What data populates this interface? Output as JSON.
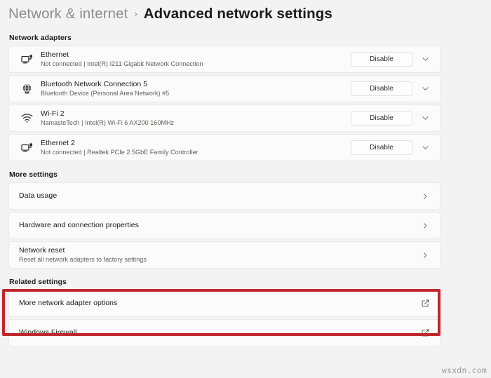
{
  "breadcrumb": {
    "parent": "Network & internet",
    "separator": "›",
    "current": "Advanced network settings"
  },
  "sections": {
    "network_adapters": {
      "label": "Network adapters",
      "adapters": [
        {
          "icon": "ethernet-icon",
          "title": "Ethernet",
          "subtitle": "Not connected | Intel(R) I211 Gigabit Network Connection",
          "button_label": "Disable",
          "expander": "chevron-down-icon"
        },
        {
          "icon": "bluetooth-network-icon",
          "title": "Bluetooth Network Connection 5",
          "subtitle": "Bluetooth Device (Personal Area Network) #5",
          "button_label": "Disable",
          "expander": "chevron-down-icon"
        },
        {
          "icon": "wifi-icon",
          "title": "Wi-Fi 2",
          "subtitle": "NamasteTech | Intel(R) Wi-Fi 6 AX200 160MHz",
          "button_label": "Disable",
          "expander": "chevron-down-icon"
        },
        {
          "icon": "ethernet-icon",
          "title": "Ethernet 2",
          "subtitle": "Not connected | Realtek PCIe 2.5GbE Family Controller",
          "button_label": "Disable",
          "expander": "chevron-down-icon"
        }
      ]
    },
    "more_settings": {
      "label": "More settings",
      "items": [
        {
          "title": "Data usage",
          "subtitle": "",
          "action_icon": "chevron-right-icon"
        },
        {
          "title": "Hardware and connection properties",
          "subtitle": "",
          "action_icon": "chevron-right-icon"
        },
        {
          "title": "Network reset",
          "subtitle": "Reset all network adapters to factory settings",
          "action_icon": "chevron-right-icon"
        }
      ]
    },
    "related_settings": {
      "label": "Related settings",
      "items": [
        {
          "title": "More network adapter options",
          "subtitle": "",
          "action_icon": "external-link-icon"
        },
        {
          "title": "Windows Firewall",
          "subtitle": "",
          "action_icon": "external-link-icon"
        }
      ]
    }
  },
  "annotation": {
    "color": "#c0272d",
    "target": "More network adapter options"
  },
  "watermark": "wsxdn.com",
  "colors": {
    "page_background": "#f3f3f3",
    "card_background": "#fbfbfb",
    "card_border": "#e9e9e9",
    "text_primary": "#1b1b1b",
    "text_secondary": "#60605f",
    "highlight": "#c0272d"
  }
}
